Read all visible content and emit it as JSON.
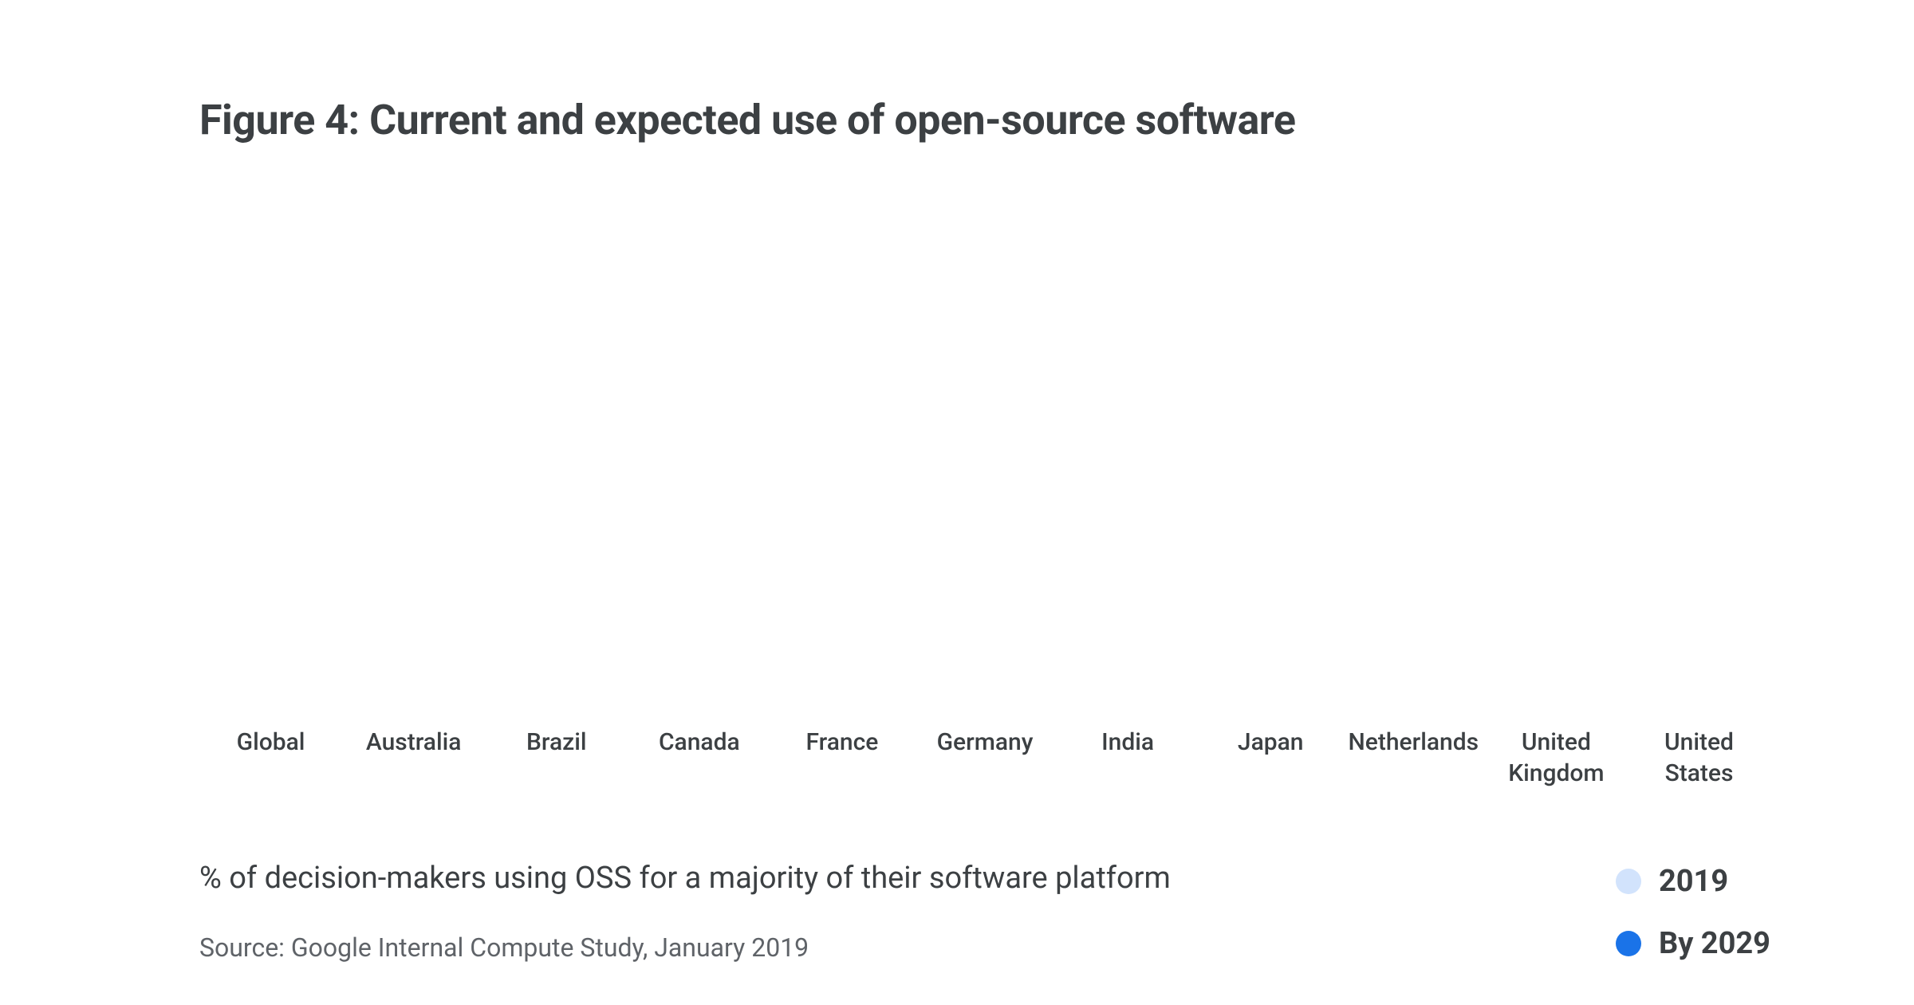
{
  "title": "Figure 4: Current and expected use of open-source software",
  "caption": "% of decision-makers using OSS for a majority of their software platform",
  "source": "Source: Google Internal Compute Study, January 2019",
  "legend": {
    "items": [
      {
        "label": "2019",
        "color": "#d2e3fc"
      },
      {
        "label": "By 2029",
        "color": "#1a73e8"
      }
    ]
  },
  "chart_data": {
    "type": "bar",
    "categories": [
      "Global",
      "Australia",
      "Brazil",
      "Canada",
      "France",
      "Germany",
      "India",
      "Japan",
      "Netherlands",
      "United\nKingdom",
      "United\nStates"
    ],
    "series": [
      {
        "name": "2019",
        "color": "#d2e3fc",
        "values": [
          null,
          null,
          null,
          null,
          null,
          null,
          null,
          null,
          null,
          null,
          null
        ]
      },
      {
        "name": "By 2029",
        "color": "#1a73e8",
        "values": [
          null,
          null,
          null,
          null,
          null,
          null,
          null,
          null,
          null,
          null,
          null
        ]
      }
    ],
    "title": "Figure 4: Current and expected use of open-source software",
    "xlabel": "",
    "ylabel": "% of decision-makers using OSS for a majority of their software platform",
    "ylim": null,
    "note": "Bars are not rendered in the screenshot; only category labels, legend, caption and source are visible."
  }
}
